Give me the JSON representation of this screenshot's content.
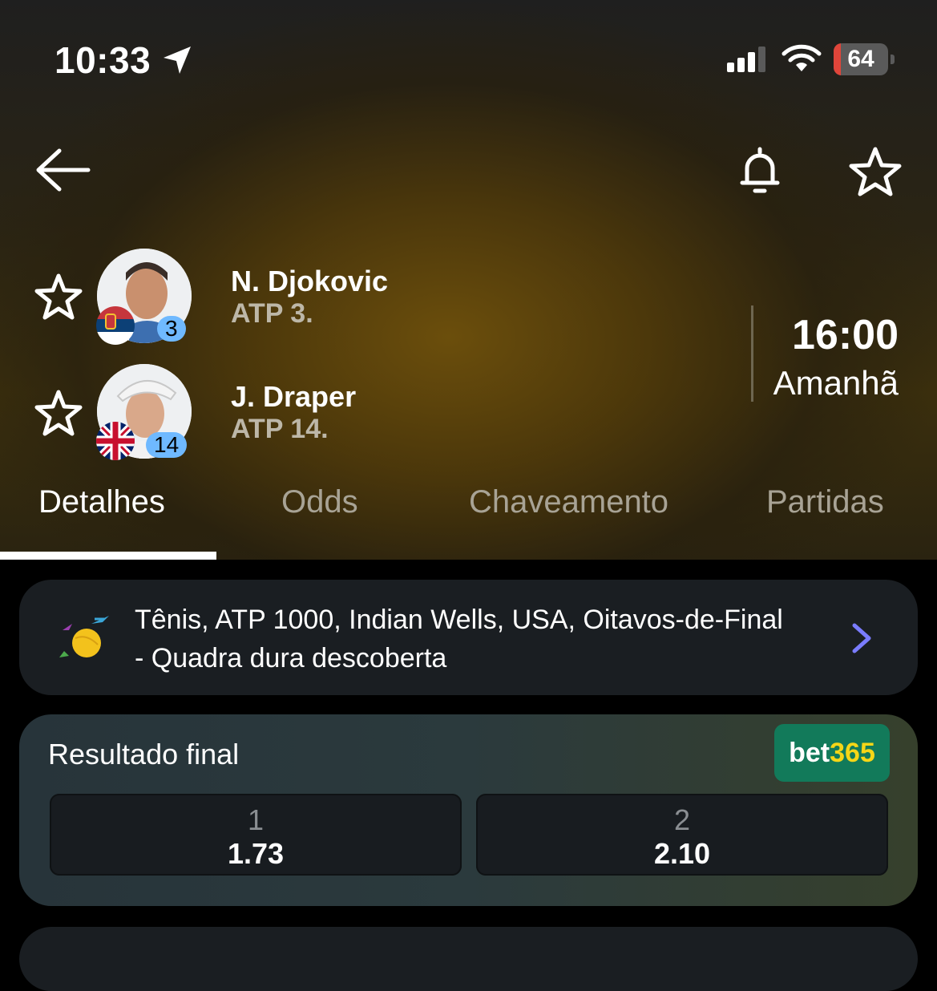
{
  "status_bar": {
    "time": "10:33",
    "battery": "64",
    "battery_level": 0.64,
    "icons": [
      "location-arrow-icon",
      "signal-icon",
      "wifi-icon",
      "battery-icon"
    ]
  },
  "nav": {
    "icons": [
      "back-arrow-icon",
      "bell-icon",
      "star-icon"
    ]
  },
  "players": [
    {
      "name": "N. Djokovic",
      "rank_text": "ATP 3.",
      "badge": "3",
      "flag": "serbia-flag"
    },
    {
      "name": "J. Draper",
      "rank_text": "ATP 14.",
      "badge": "14",
      "flag": "uk-flag"
    }
  ],
  "match": {
    "time": "16:00",
    "day": "Amanhã"
  },
  "tabs": [
    {
      "label": "Detalhes",
      "active": true
    },
    {
      "label": "Odds",
      "active": false
    },
    {
      "label": "Chaveamento",
      "active": false
    },
    {
      "label": "Partidas",
      "active": false
    }
  ],
  "tournament": {
    "line1": "Tênis, ATP 1000, Indian Wells, USA, Oitavos-de-Final",
    "line2": "- Quadra dura descoberta",
    "logo": "indian-wells-logo-icon"
  },
  "odds": {
    "title": "Resultado final",
    "bookmaker_a": "bet",
    "bookmaker_b": "365",
    "options": [
      {
        "label": "1",
        "value": "1.73"
      },
      {
        "label": "2",
        "value": "2.10"
      }
    ]
  },
  "colors": {
    "accent_blue": "#6fb9ff",
    "bookmaker_green": "#127a5a",
    "bookmaker_yellow": "#f5d617",
    "chevron": "#7a7cff"
  }
}
